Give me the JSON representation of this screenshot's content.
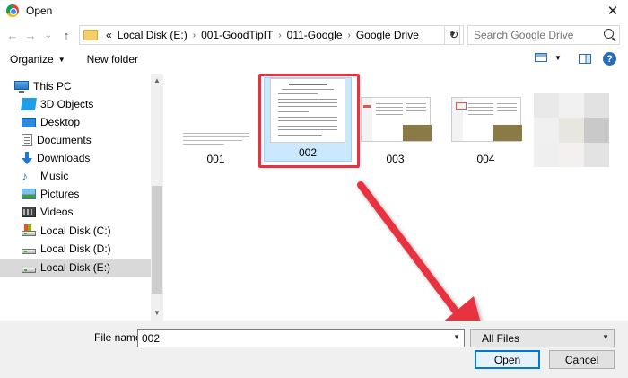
{
  "window": {
    "title": "Open",
    "close_glyph": "✕"
  },
  "nav": {
    "back_glyph": "←",
    "forward_glyph": "→",
    "recent_glyph": "⌄",
    "up_glyph": "↑",
    "refresh_glyph": "↻",
    "breadcrumb": [
      "«",
      "Local Disk (E:)",
      "001-GoodTipIT",
      "011-Google",
      "Google Drive"
    ],
    "breadcrumb_sep": "›",
    "search_placeholder": "Search Google Drive"
  },
  "toolbar": {
    "organize": "Organize",
    "new_folder": "New folder",
    "caret": "▼"
  },
  "sidebar": {
    "items": [
      {
        "label": "This PC",
        "icon": "pc-icon"
      },
      {
        "label": "3D Objects",
        "icon": "3d-objects-icon"
      },
      {
        "label": "Desktop",
        "icon": "desktop-icon"
      },
      {
        "label": "Documents",
        "icon": "documents-icon"
      },
      {
        "label": "Downloads",
        "icon": "downloads-icon"
      },
      {
        "label": "Music",
        "icon": "music-icon"
      },
      {
        "label": "Pictures",
        "icon": "pictures-icon"
      },
      {
        "label": "Videos",
        "icon": "videos-icon"
      },
      {
        "label": "Local Disk (C:)",
        "icon": "drive-icon"
      },
      {
        "label": "Local Disk (D:)",
        "icon": "drive-icon"
      },
      {
        "label": "Local Disk (E:)",
        "icon": "drive-icon",
        "selected": true
      }
    ],
    "scroll_up": "▲",
    "scroll_down": "▼"
  },
  "files": [
    {
      "name": "001"
    },
    {
      "name": "002",
      "selected": true
    },
    {
      "name": "003"
    },
    {
      "name": "004"
    },
    {
      "name": ""
    }
  ],
  "bottom": {
    "file_name_label": "File name:",
    "file_name_value": "002",
    "file_type": "All Files",
    "open_button": "Open",
    "cancel_button": "Cancel",
    "dropdown_glyph": "▼"
  },
  "colors": {
    "selection": "#cce8ff",
    "annotation": "#e8323f",
    "accent": "#0078d7"
  }
}
